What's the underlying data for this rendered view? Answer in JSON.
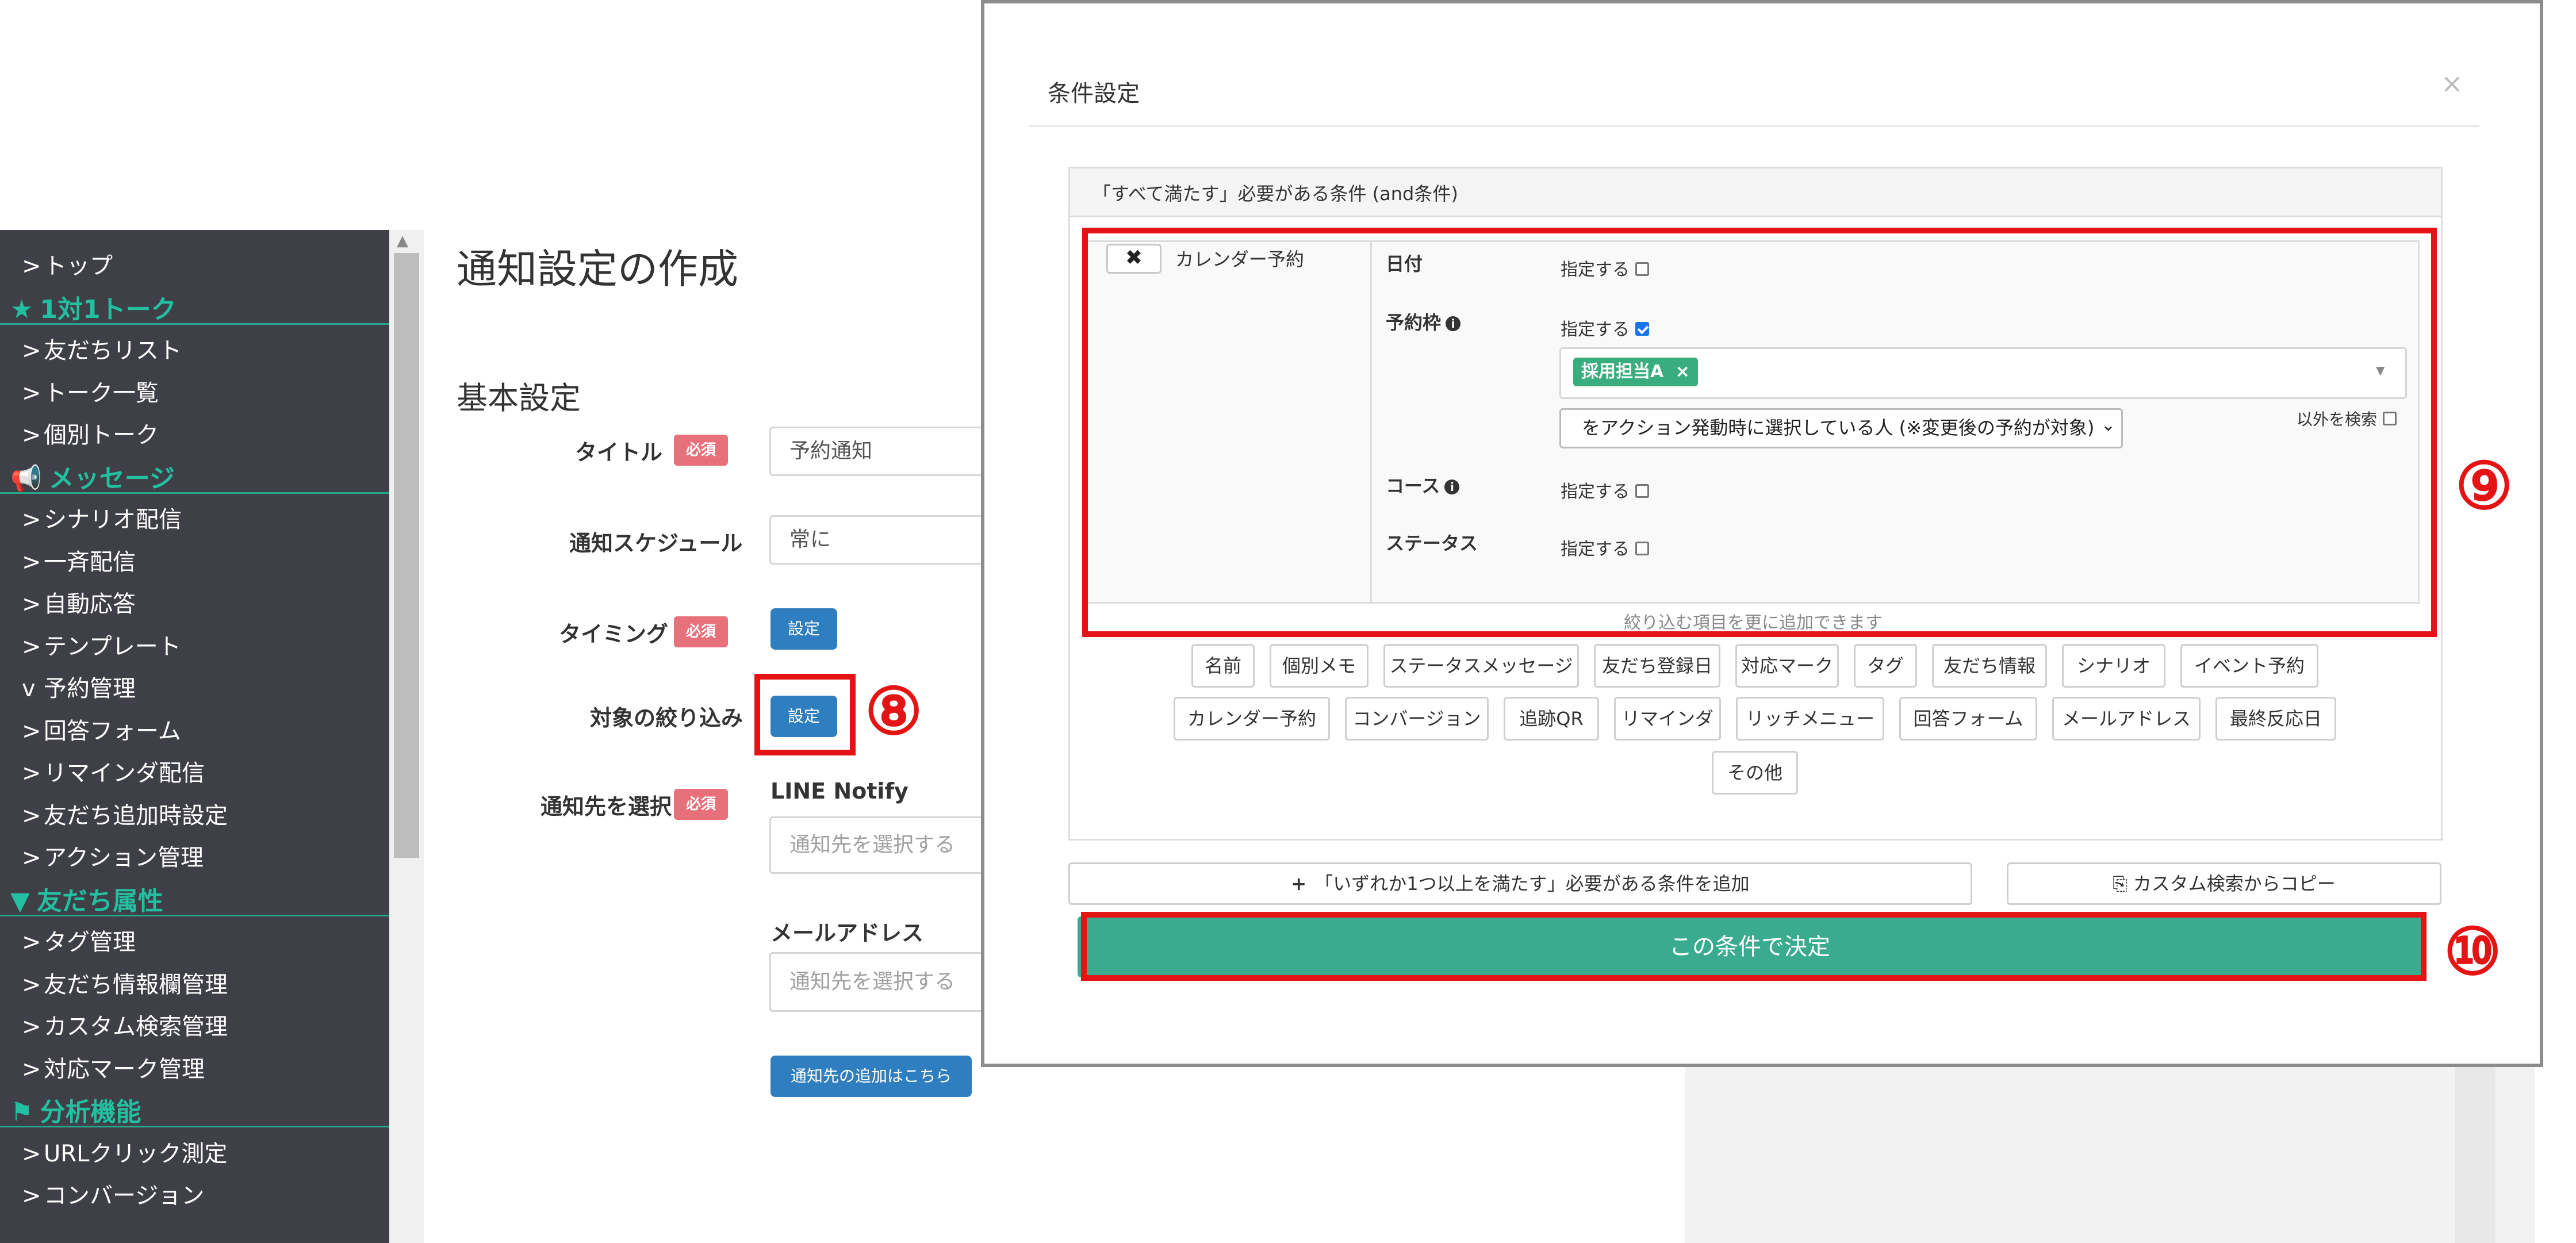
{
  "sidebar": {
    "items": [
      {
        "type": "item",
        "label": "トップ",
        "chevron": ">"
      },
      {
        "type": "section",
        "label": "1対1トーク",
        "icon": "★"
      },
      {
        "type": "item",
        "label": "友だちリスト",
        "chevron": ">"
      },
      {
        "type": "item",
        "label": "トーク一覧",
        "chevron": ">"
      },
      {
        "type": "item",
        "label": "個別トーク",
        "chevron": ">"
      },
      {
        "type": "section",
        "label": "メッセージ",
        "icon": "📢"
      },
      {
        "type": "item",
        "label": "シナリオ配信",
        "chevron": ">"
      },
      {
        "type": "item",
        "label": "一斉配信",
        "chevron": ">"
      },
      {
        "type": "item",
        "label": "自動応答",
        "chevron": ">"
      },
      {
        "type": "item",
        "label": "テンプレート",
        "chevron": ">"
      },
      {
        "type": "item",
        "label": "予約管理",
        "chevron": "v"
      },
      {
        "type": "item",
        "label": "回答フォーム",
        "chevron": ">"
      },
      {
        "type": "item",
        "label": "リマインダ配信",
        "chevron": ">"
      },
      {
        "type": "item",
        "label": "友だち追加時設定",
        "chevron": ">"
      },
      {
        "type": "item",
        "label": "アクション管理",
        "chevron": ">"
      },
      {
        "type": "section",
        "label": "友だち属性",
        "icon": "▼"
      },
      {
        "type": "item",
        "label": "タグ管理",
        "chevron": ">"
      },
      {
        "type": "item",
        "label": "友だち情報欄管理",
        "chevron": ">"
      },
      {
        "type": "item",
        "label": "カスタム検索管理",
        "chevron": ">"
      },
      {
        "type": "item",
        "label": "対応マーク管理",
        "chevron": ">"
      },
      {
        "type": "section",
        "label": "分析機能",
        "icon": "⚑"
      },
      {
        "type": "item",
        "label": "URLクリック測定",
        "chevron": ">"
      },
      {
        "type": "item",
        "label": "コンバージョン",
        "chevron": ">"
      }
    ]
  },
  "main": {
    "page_title": "通知設定の作成",
    "section_title": "基本設定",
    "required_badge": "必須",
    "title_label": "タイトル",
    "title_value": "予約通知",
    "schedule_label": "通知スケジュール",
    "schedule_value": "常に",
    "timing_label": "タイミング",
    "timing_button": "設定",
    "filter_label": "対象の絞り込み",
    "filter_button": "設定",
    "dest_label": "通知先を選択",
    "line_notify_label": "LINE Notify",
    "line_notify_placeholder": "通知先を選択する",
    "email_label": "メールアドレス",
    "email_placeholder": "通知先を選択する",
    "add_dest_button": "通知先の追加はこちら"
  },
  "annotations": {
    "n8": "⑧",
    "n9": "⑨",
    "n10": "⑩"
  },
  "modal": {
    "title": "条件設定",
    "close": "×",
    "panel_header": "「すべて満たす」必要がある条件 (and条件)",
    "condition": {
      "delete_icon": "✖",
      "name": "カレンダー予約",
      "date_label": "日付",
      "slot_label": "予約枠",
      "course_label": "コース",
      "status_label": "ステータス",
      "specify": "指定する",
      "selected_tag": "採用担当A",
      "tag_remove": "×",
      "who_select": "をアクション発動時に選択している人 (※変更後の予約が対象)",
      "exclude_label": "以外を検索",
      "date_checked": false,
      "slot_checked": true,
      "course_checked": false,
      "status_checked": false
    },
    "more_hint": "絞り込む項目を更に追加できます",
    "filter_buttons_row1": [
      "名前",
      "個別メモ",
      "ステータスメッセージ",
      "友だち登録日",
      "対応マーク",
      "タグ",
      "友だち情報",
      "シナリオ",
      "イベント予約"
    ],
    "filter_buttons_row2": [
      "カレンダー予約",
      "コンバージョン",
      "追跡QR",
      "リマインダ",
      "リッチメニュー",
      "回答フォーム",
      "メールアドレス",
      "最終反応日"
    ],
    "filter_buttons_row3": [
      "その他"
    ],
    "add_or_condition": "「いずれか1つ以上を満たす」必要がある条件を追加",
    "add_or_icon": "+",
    "copy_custom": "カスタム検索からコピー",
    "copy_icon": "⎘",
    "confirm": "この条件で決定"
  },
  "colors": {
    "sidebar_bg": "#3e3f47",
    "section_accent": "#22c0a0",
    "primary_button": "#2f7ebf",
    "confirm_button": "#3aab8f",
    "annotation_red": "#e41414",
    "tag_green": "#3aad7e",
    "required_badge": "#e8707a"
  }
}
